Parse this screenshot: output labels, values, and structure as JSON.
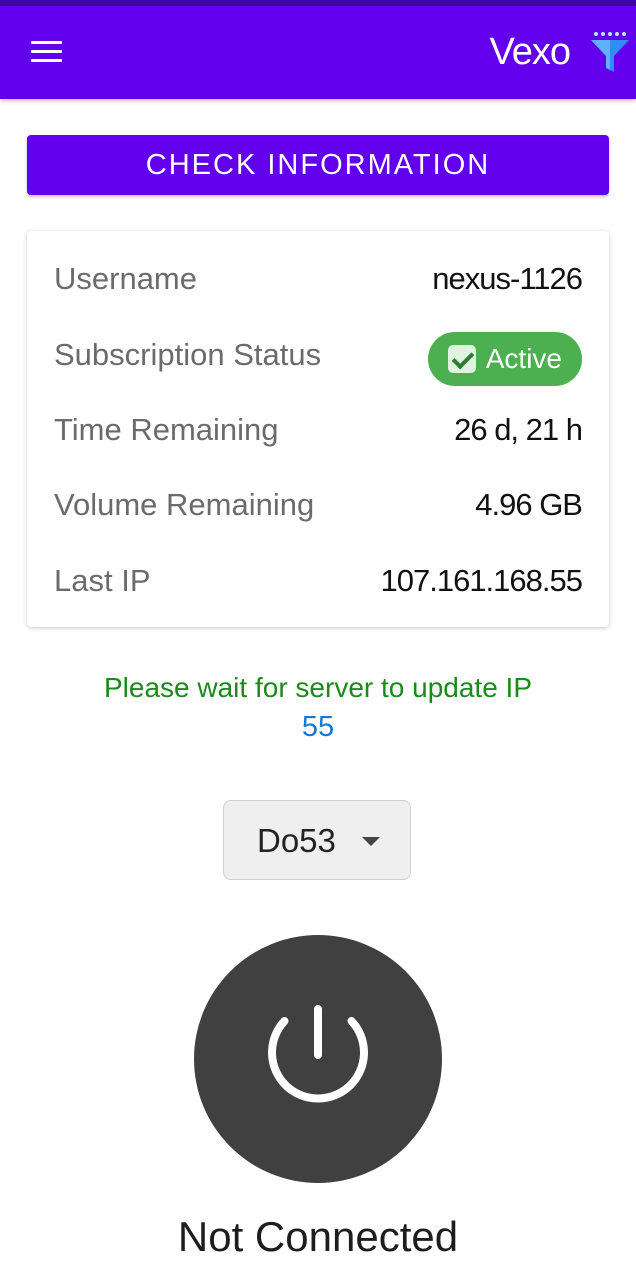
{
  "header": {
    "brand": "Vexo",
    "menu_icon": "hamburger-menu-icon",
    "filter_icon": "funnel-filter-icon"
  },
  "check_button": {
    "label": "CHECK INFORMATION"
  },
  "info_card": {
    "rows": [
      {
        "label": "Username",
        "value": "nexus-1126"
      },
      {
        "label": "Subscription Status",
        "value": "Active"
      },
      {
        "label": "Time Remaining",
        "value": "26 d, 21 h"
      },
      {
        "label": "Volume Remaining",
        "value": "4.96 GB"
      },
      {
        "label": "Last IP",
        "value": "107.161.168.55"
      }
    ]
  },
  "notice": {
    "message": "Please wait for server to update IP",
    "countdown": "55"
  },
  "protocol_select": {
    "selected": "Do53"
  },
  "connection": {
    "status": "Not Connected",
    "power_icon": "power-icon"
  },
  "colors": {
    "primary": "#6200ee",
    "status_active": "#4caf50",
    "notice_text": "#1b8a1b",
    "countdown_text": "#1976d2",
    "power_button": "#404040"
  }
}
